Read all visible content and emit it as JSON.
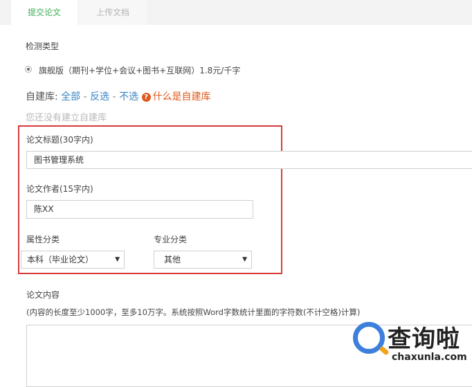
{
  "tabs": [
    {
      "label": "提交论文",
      "active": true
    },
    {
      "label": "上传文档",
      "active": false
    }
  ],
  "detection": {
    "heading": "检测类型",
    "option_label": "旗舰版（期刊+学位+会议+图书+互联网）1.8元/千字",
    "selected": true
  },
  "self_library": {
    "label": "自建库:",
    "all_link": "全部",
    "sep1": "-",
    "invert_link": "反选",
    "sep2": "-",
    "none_link": "不选",
    "help_icon": "question-circle-icon",
    "help_link": "什么是自建库",
    "empty_note": "您还没有建立自建库"
  },
  "form": {
    "title_label": "论文标题(30字内)",
    "title_value": "图书管理系统",
    "author_label": "论文作者(15字内)",
    "author_value": "陈XX",
    "attr_label": "属性分类",
    "attr_value": "本科（毕业论文）",
    "major_label": "专业分类",
    "major_value": "其他",
    "content_label": "论文内容",
    "content_note": "(内容的长度至少1000字，至多10万字。系统按照Word字数统计里面的字符数(不计空格)计算)",
    "content_value": ""
  },
  "watermark": {
    "text": "查询啦",
    "url": "chaxunla.com"
  },
  "colors": {
    "active_tab": "#3eaf54",
    "link": "#3a84c6",
    "warn": "#e05a1e",
    "highlight_box": "#d83a3a"
  }
}
